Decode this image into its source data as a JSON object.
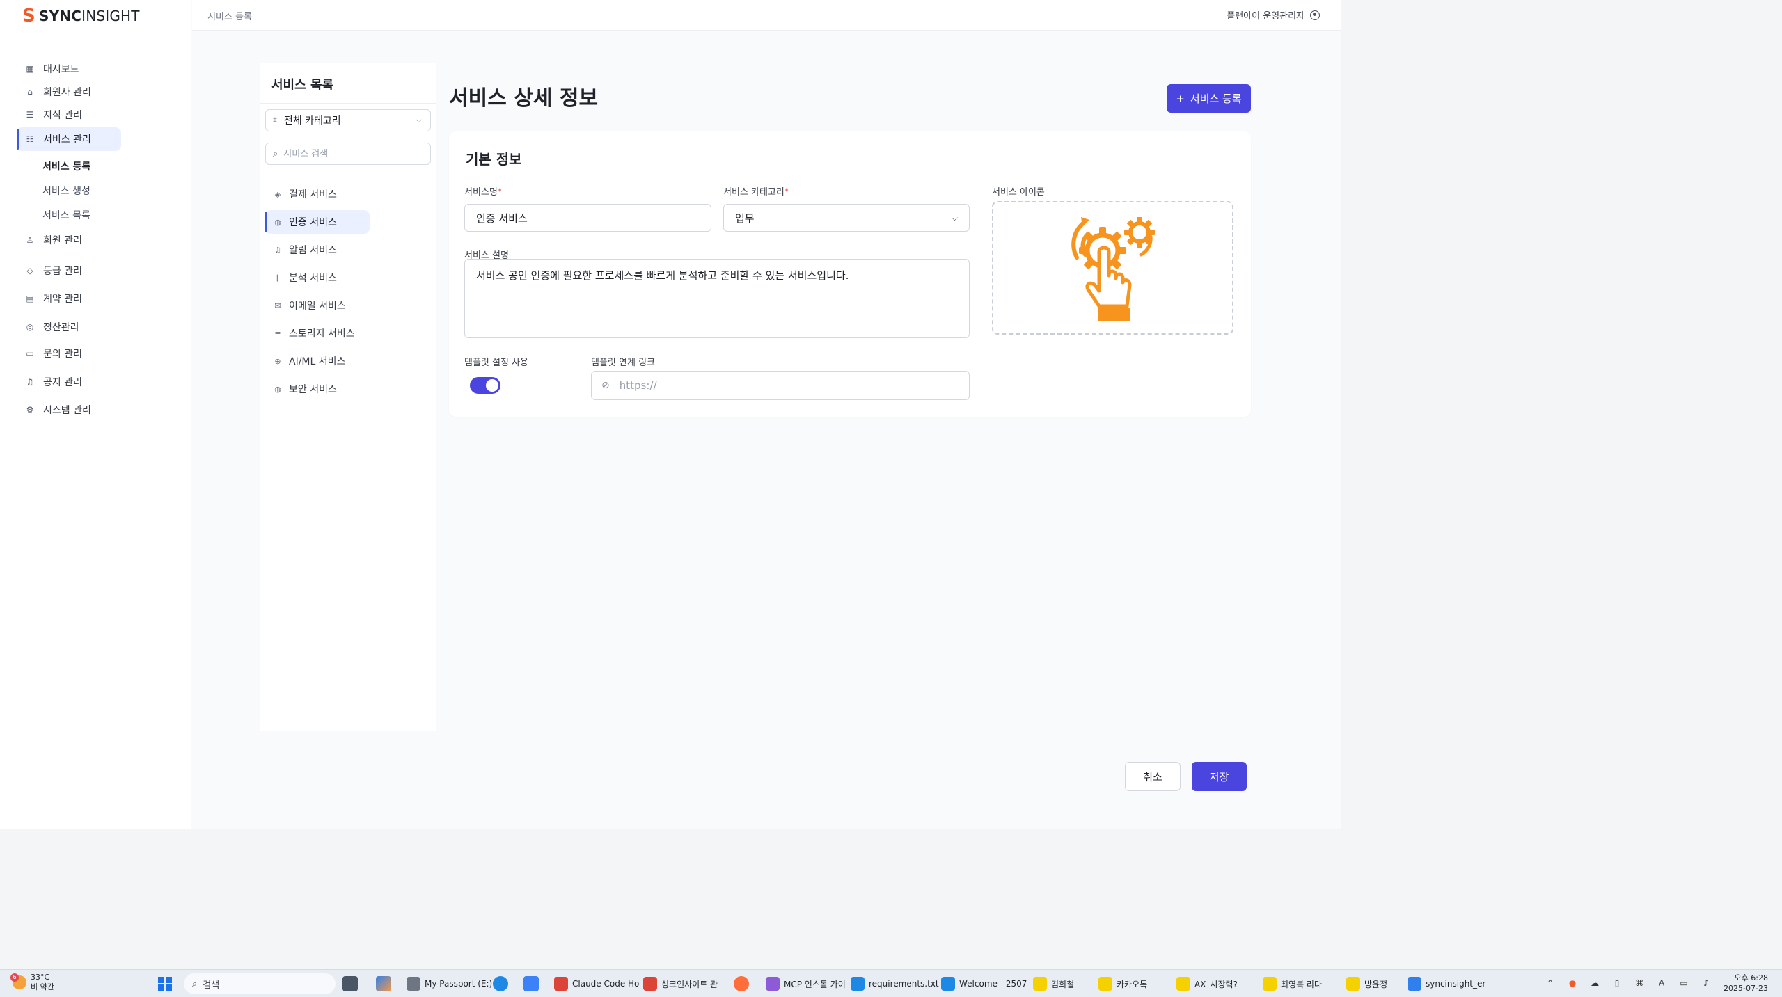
{
  "brand": {
    "name_bold": "SYNC",
    "name_thin": "INSIGHT",
    "accent": "#f15a24"
  },
  "topbar": {
    "breadcrumb": "서비스 등록",
    "user": "플랜아이 운영관리자"
  },
  "sidebar": {
    "items": [
      {
        "label": "대시보드",
        "icon": "dashboard-icon",
        "glyph": "▦"
      },
      {
        "label": "회원사 관리",
        "icon": "building-icon",
        "glyph": "⌂"
      },
      {
        "label": "지식 관리",
        "icon": "database-icon",
        "glyph": "☰"
      },
      {
        "label": "서비스 관리",
        "icon": "service-icon",
        "glyph": "☷",
        "active": true
      },
      {
        "label": "회원 관리",
        "icon": "user-icon",
        "glyph": "♙"
      },
      {
        "label": "등급 관리",
        "icon": "diamond-icon",
        "glyph": "◇"
      },
      {
        "label": "계약 관리",
        "icon": "document-icon",
        "glyph": "▤"
      },
      {
        "label": "정산관리",
        "icon": "coin-icon",
        "glyph": "◎"
      },
      {
        "label": "문의 관리",
        "icon": "chat-icon",
        "glyph": "▭"
      },
      {
        "label": "공지 관리",
        "icon": "bell-icon",
        "glyph": "♫"
      },
      {
        "label": "시스템 관리",
        "icon": "gear-icon",
        "glyph": "⚙"
      }
    ],
    "sub_items": [
      {
        "label": "서비스 등록",
        "active": true
      },
      {
        "label": "서비스 생성"
      },
      {
        "label": "서비스 목록"
      }
    ]
  },
  "service_list": {
    "title": "서비스 목록",
    "category_select": "전체 카테고리",
    "search_placeholder": "서비스 검색",
    "items": [
      {
        "label": "결제 서비스",
        "icon": "payment-icon",
        "glyph": "◈"
      },
      {
        "label": "인증 서비스",
        "icon": "shield-icon",
        "glyph": "◍",
        "active": true
      },
      {
        "label": "알림 서비스",
        "icon": "bell-icon",
        "glyph": "♫"
      },
      {
        "label": "분석 서비스",
        "icon": "chart-icon",
        "glyph": "⌊"
      },
      {
        "label": "이메일 서비스",
        "icon": "mail-icon",
        "glyph": "✉"
      },
      {
        "label": "스토리지 서비스",
        "icon": "storage-icon",
        "glyph": "≡"
      },
      {
        "label": "AI/ML 서비스",
        "icon": "ai-icon",
        "glyph": "⊕"
      },
      {
        "label": "보안 서비스",
        "icon": "security-icon",
        "glyph": "◍"
      }
    ]
  },
  "detail": {
    "title": "서비스 상세 정보",
    "register_button": "서비스 등록",
    "card_title": "기본 정보",
    "name_label": "서비스명",
    "name_value": "인증 서비스",
    "category_label": "서비스 카테고리",
    "category_value": "업무",
    "icon_label": "서비스 아이콘",
    "desc_label": "서비스 설명",
    "desc_value": "서비스 공인 인증에 필요한 프로세스를 빠르게 분석하고 준비할 수 있는 서비스입니다.",
    "template_toggle_label": "템플릿 설정 사용",
    "template_toggle_on": true,
    "template_link_label": "템플릿 연계 링크",
    "template_link_placeholder": "https://",
    "required_mark": "*"
  },
  "actions": {
    "cancel": "취소",
    "save": "저장"
  },
  "colors": {
    "primary": "#4b45e0",
    "active_bg": "#eaf0ff",
    "icon_orange": "#f7941d"
  },
  "taskbar": {
    "weather_temp": "33°C",
    "weather_desc": "비 약간",
    "weather_badge": "6",
    "search": "검색",
    "apps": [
      {
        "label": "My Passport (E:)",
        "color": "#6d7682"
      },
      {
        "label": "Claude Code Ho",
        "color": "#db4437"
      },
      {
        "label": "싱크인사이트 관",
        "color": "#db4437"
      },
      {
        "label": "MCP 인스톨 가이",
        "color": "#8e5bd8"
      },
      {
        "label": "requirements.txt",
        "color": "#1e88e5"
      },
      {
        "label": "Welcome - 2507",
        "color": "#1e88e5"
      },
      {
        "label": "김희철",
        "color": "#f5d100"
      },
      {
        "label": "카카오톡",
        "color": "#f5d100"
      },
      {
        "label": "AX_시장력?",
        "color": "#f5d100"
      },
      {
        "label": "최영복 리다",
        "color": "#f5d100"
      },
      {
        "label": "방윤정",
        "color": "#f5d100"
      },
      {
        "label": "syncinsight_er",
        "color": "#2f80ed"
      }
    ],
    "time": "오후 6:28",
    "date": "2025-07-23",
    "ime": "A"
  }
}
